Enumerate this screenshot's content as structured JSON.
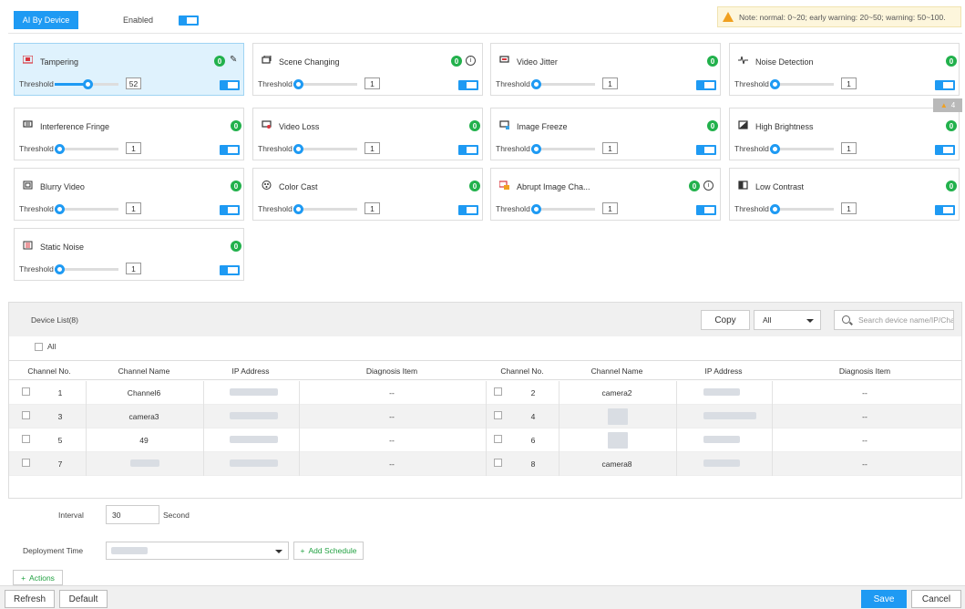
{
  "header": {
    "tab_label": "AI By Device",
    "enabled_label": "Enabled",
    "note": "Note: normal: 0~20; early warning: 20~50; warning: 50~100."
  },
  "threshold_label": "Threshold",
  "cards": [
    {
      "title": "Tampering",
      "count": "0",
      "threshold": "52",
      "level": 0.52,
      "icon": "tampering-icon",
      "enabled": true
    },
    {
      "title": "Scene Changing",
      "count": "0",
      "threshold": "1",
      "level": 0.01,
      "icon": "scene-changing-icon",
      "enabled": true
    },
    {
      "title": "Video Jitter",
      "count": "0",
      "threshold": "1",
      "level": 0.01,
      "icon": "video-jitter-icon",
      "enabled": true
    },
    {
      "title": "Noise Detection",
      "count": "0",
      "threshold": "1",
      "level": 0.01,
      "icon": "noise-detection-icon",
      "enabled": true
    },
    {
      "title": "Interference Fringe",
      "count": "0",
      "threshold": "1",
      "level": 0.01,
      "icon": "interference-fringe-icon",
      "enabled": true
    },
    {
      "title": "Video Loss",
      "count": "0",
      "threshold": "1",
      "level": 0.01,
      "icon": "video-loss-icon",
      "enabled": true
    },
    {
      "title": "Image Freeze",
      "count": "0",
      "threshold": "1",
      "level": 0.01,
      "icon": "image-freeze-icon",
      "enabled": true
    },
    {
      "title": "High Brightness",
      "count": "0",
      "threshold": "1",
      "level": 0.01,
      "icon": "high-brightness-icon",
      "enabled": true
    },
    {
      "title": "Blurry Video",
      "count": "0",
      "threshold": "1",
      "level": 0.01,
      "icon": "blurry-video-icon",
      "enabled": true
    },
    {
      "title": "Color Cast",
      "count": "0",
      "threshold": "1",
      "level": 0.01,
      "icon": "color-cast-icon",
      "enabled": true
    },
    {
      "title": "Abrupt Image Cha...",
      "count": "0",
      "threshold": "1",
      "level": 0.01,
      "icon": "abrupt-image-change-icon",
      "enabled": true
    },
    {
      "title": "Low Contrast",
      "count": "0",
      "threshold": "1",
      "level": 0.01,
      "icon": "low-contrast-icon",
      "enabled": true
    },
    {
      "title": "Static Noise",
      "count": "0",
      "threshold": "1",
      "level": 0.01,
      "icon": "static-noise-icon",
      "enabled": true
    }
  ],
  "side_badge": "4",
  "device_list": {
    "title": "Device List(8)",
    "copy_label": "Copy",
    "filter_value": "All",
    "search_placeholder": "Search device name/IP/Cha",
    "all_label": "All",
    "columns": [
      "Channel No.",
      "Channel Name",
      "IP Address",
      "Diagnosis Item"
    ],
    "rows": [
      {
        "left": {
          "no": "1",
          "name": "Channel6",
          "diag": "--"
        },
        "right": {
          "no": "2",
          "name": "camera2",
          "diag": "--"
        }
      },
      {
        "left": {
          "no": "3",
          "name": "camera3",
          "diag": "--"
        },
        "right": {
          "no": "4",
          "name": "",
          "diag": "--"
        }
      },
      {
        "left": {
          "no": "5",
          "name": "49",
          "diag": "--"
        },
        "right": {
          "no": "6",
          "name": "",
          "diag": "--"
        }
      },
      {
        "left": {
          "no": "7",
          "name": "",
          "diag": "--"
        },
        "right": {
          "no": "8",
          "name": "camera8",
          "diag": "--"
        }
      }
    ]
  },
  "interval": {
    "label": "Interval",
    "value": "30",
    "unit": "Second"
  },
  "deployment": {
    "label": "Deployment Time",
    "add_schedule": "Add Schedule"
  },
  "actions_label": "Actions",
  "footer": {
    "refresh": "Refresh",
    "default": "Default",
    "save": "Save",
    "cancel": "Cancel"
  },
  "colors": {
    "accent": "#1e9af3",
    "badge": "#22b14c",
    "active_card": "#dff2fd",
    "add": "#22a142"
  }
}
